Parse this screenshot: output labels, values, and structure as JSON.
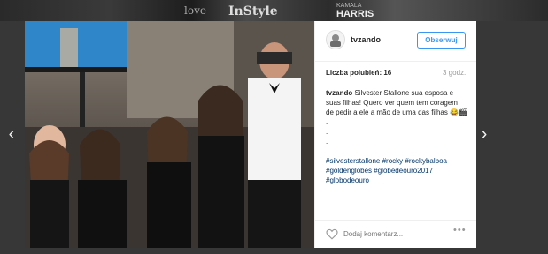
{
  "backdrop": {
    "brand_love": "love",
    "brand_instyle": "InStyle",
    "brand_kamala": "KAMALA",
    "brand_harris": "HARRIS"
  },
  "post": {
    "username": "tvzando",
    "follow_label": "Obserwuj",
    "likes_label": "Liczba polubień: 16",
    "time_ago": "3 godz.",
    "caption_text": "Silvester Stallone sua esposa e suas filhas! Quero ver quem tem coragem de pedir a ele a mão de uma das filhas 😂🎬",
    "caption_dots": [
      ".",
      ".",
      ".",
      "."
    ],
    "hashtags": [
      "#silvesterstallone",
      "#rocky",
      "#rockybalboa",
      "#goldenglobes",
      "#globedeouro2017",
      "#globodeouro"
    ],
    "comment_placeholder": "Dodaj komentarz...",
    "more_label": "•••"
  },
  "icons": {
    "prev": "chevron-left-icon",
    "next": "chevron-right-icon",
    "like": "heart-icon",
    "more": "more-options-icon"
  },
  "colors": {
    "accent": "#3897f0",
    "hashtag": "#003569",
    "text": "#262626",
    "muted": "#999999",
    "backdrop": "#373737"
  }
}
